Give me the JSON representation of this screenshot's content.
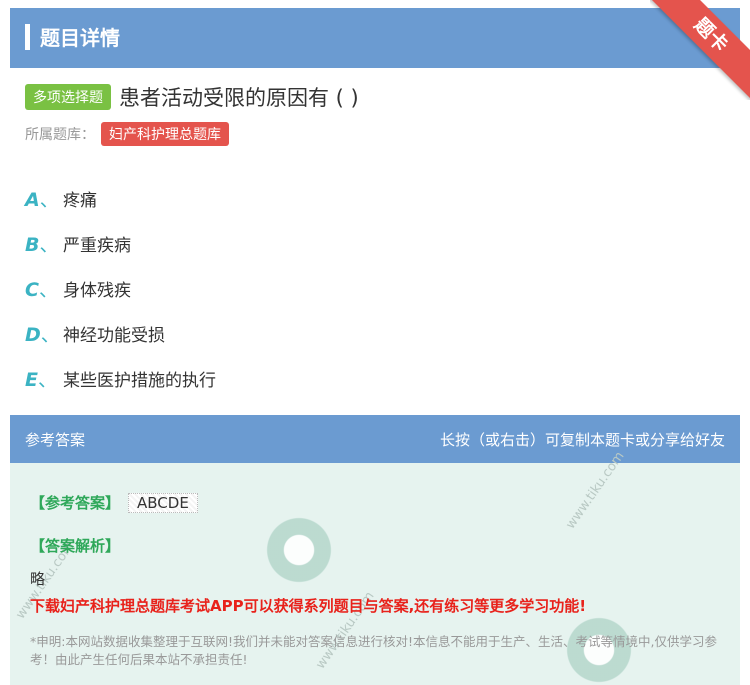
{
  "header": {
    "title": "题目详情",
    "ribbon": "题卡"
  },
  "question": {
    "type_badge": "多项选择题",
    "text": "患者活动受限的原因有 ( )",
    "bank_label": "所属题库：",
    "bank_name": "妇产科护理总题库"
  },
  "options": [
    {
      "letter": "A",
      "sep": "、",
      "text": "疼痛"
    },
    {
      "letter": "B",
      "sep": "、",
      "text": "严重疾病"
    },
    {
      "letter": "C",
      "sep": "、",
      "text": "身体残疾"
    },
    {
      "letter": "D",
      "sep": "、",
      "text": "神经功能受损"
    },
    {
      "letter": "E",
      "sep": "、",
      "text": "某些医护措施的执行"
    }
  ],
  "answer": {
    "head_left": "参考答案",
    "head_right": "长按（或右击）可复制本题卡或分享给好友",
    "answer_tag": "【参考答案】",
    "answer_value": "ABCDE",
    "analysis_tag": "【答案解析】",
    "analysis_text": "略",
    "download_text": "下载妇产科护理总题库考试APP可以获得系列题目与答案,还有练习等更多学习功能!",
    "disclaimer": "*申明:本网站数据收集整理于互联网!我们并未能对答案信息进行核对!本信息不能用于生产、生活、考试等情境中,仅供学习参考！由此产生任何后果本站不承担责任!"
  },
  "watermark": {
    "text": "www.tiku.com"
  },
  "colors": {
    "header": "#6b9bd1",
    "badge_green": "#7ac143",
    "badge_red": "#e4544d",
    "option_letter": "#3bb3c3",
    "answer_bg": "#e6f3ef"
  }
}
